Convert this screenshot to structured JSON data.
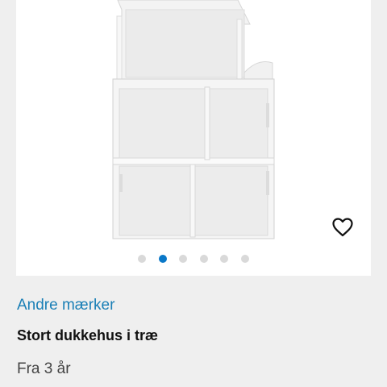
{
  "product": {
    "brand": "Andre mærker",
    "title": "Stort dukkehus i træ",
    "age": "Fra 3 år"
  },
  "gallery": {
    "image_count": 6,
    "active_index": 1,
    "active_color": "#0a78c8",
    "inactive_color": "#d9d9d9"
  },
  "icons": {
    "wishlist": "heart-outline-icon"
  },
  "colors": {
    "brand_link": "#1a7fb6",
    "page_background": "#efefef"
  }
}
